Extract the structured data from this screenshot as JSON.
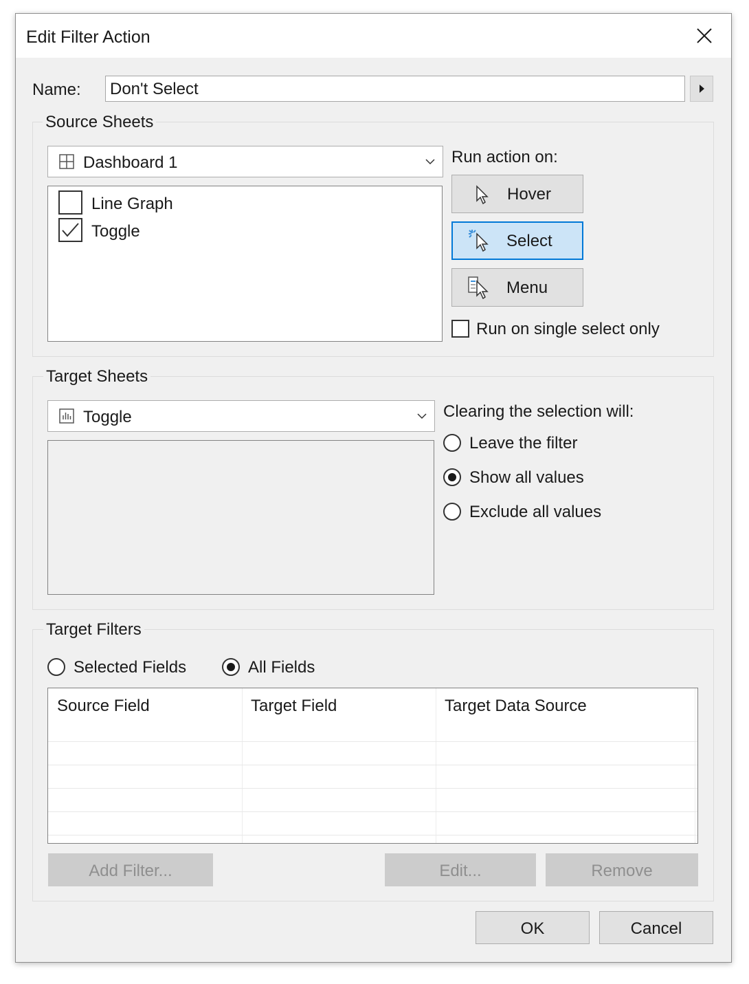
{
  "dialog": {
    "title": "Edit Filter Action",
    "close_icon": "close-icon"
  },
  "name_row": {
    "label": "Name:",
    "value": "Don't Select",
    "menu_icon": "triangle-right-icon"
  },
  "source_sheets": {
    "legend": "Source Sheets",
    "selected_sheet": "Dashboard 1",
    "sheet_icon": "dashboard-icon",
    "sheets": [
      {
        "label": "Line Graph",
        "checked": false
      },
      {
        "label": "Toggle",
        "checked": true
      }
    ],
    "run_action_label": "Run action on:",
    "run_buttons": [
      {
        "label": "Hover",
        "icon": "hover-cursor-icon",
        "active": false
      },
      {
        "label": "Select",
        "icon": "select-cursor-icon",
        "active": true
      },
      {
        "label": "Menu",
        "icon": "menu-cursor-icon",
        "active": false
      }
    ],
    "single_select_label": "Run on single select only",
    "single_select_checked": false
  },
  "target_sheets": {
    "legend": "Target Sheets",
    "selected_sheet": "Toggle",
    "sheet_icon": "worksheet-icon",
    "clearing_label": "Clearing the selection will:",
    "clearing_options": [
      {
        "label": "Leave the filter",
        "selected": false
      },
      {
        "label": "Show all values",
        "selected": true
      },
      {
        "label": "Exclude all values",
        "selected": false
      }
    ]
  },
  "target_filters": {
    "legend": "Target Filters",
    "modes": [
      {
        "label": "Selected Fields",
        "selected": false
      },
      {
        "label": "All Fields",
        "selected": true
      }
    ],
    "columns": [
      "Source Field",
      "Target Field",
      "Target Data Source"
    ],
    "add_label": "Add Filter...",
    "edit_label": "Edit...",
    "remove_label": "Remove"
  },
  "footer": {
    "ok_label": "OK",
    "cancel_label": "Cancel"
  },
  "colors": {
    "accent": "#0078d7",
    "active_fill": "#cce4f7",
    "dialog_bg": "#f0f0f0"
  }
}
